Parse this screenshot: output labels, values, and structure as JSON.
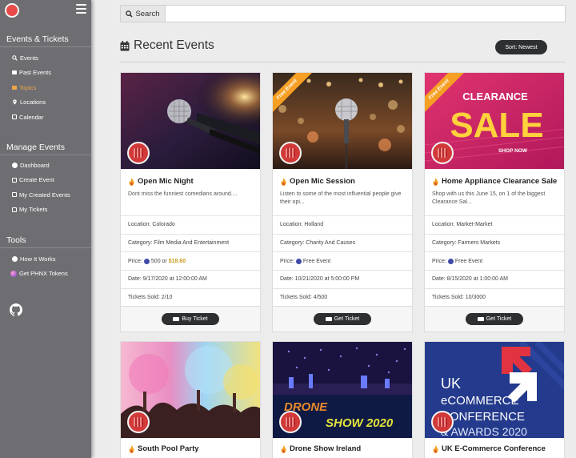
{
  "sidebar": {
    "sections": [
      {
        "title": "Events & Tickets",
        "items": [
          {
            "label": "Events",
            "icon": "search-icon"
          },
          {
            "label": "Past Events",
            "icon": "archive-icon"
          },
          {
            "label": "Topics",
            "icon": "folder-icon",
            "active": true
          },
          {
            "label": "Locations",
            "icon": "map-marker-icon"
          },
          {
            "label": "Calendar",
            "icon": "calendar-icon"
          }
        ]
      },
      {
        "title": "Manage Events",
        "items": [
          {
            "label": "Dashboard",
            "icon": "dashboard-icon"
          },
          {
            "label": "Create Event",
            "icon": "edit-icon"
          },
          {
            "label": "My Created Events",
            "icon": "list-icon"
          },
          {
            "label": "My Tickets",
            "icon": "ticket-icon"
          }
        ]
      },
      {
        "title": "Tools",
        "items": [
          {
            "label": "How It Works",
            "icon": "question-circle-icon"
          },
          {
            "label": "Get PHNX Tokens",
            "icon": "phnx-token-icon"
          }
        ]
      }
    ]
  },
  "search": {
    "button_label": "Search",
    "placeholder": ""
  },
  "page": {
    "title": "Recent Events",
    "sort_label": "Sort: Newest"
  },
  "colors": {
    "accent": "#f0a64a",
    "sidebar": "#6e6e72",
    "button": "#2e2f31",
    "ribbon": "#f5a025"
  },
  "cards": [
    {
      "title": "Open Mic Night",
      "desc": "Dont miss the funniest comedians around....",
      "location": "Location: Colorado",
      "category": "Category: Film Media And Entertainment",
      "price_prefix": "Price: ",
      "price_phnx": "500 or ",
      "price_usd": "$18.60",
      "date": "Date: 9/17/2020 at 12:00:00 AM",
      "tickets": "Tickets Sold: 2/10",
      "button": "Buy Ticket"
    },
    {
      "ribbon": "Free Event",
      "title": "Open Mic Session",
      "desc": "Listen to some of the most influential people give their opi...",
      "location": "Location: Holland",
      "category": "Category: Charity And Causes",
      "price_prefix": "Price: ",
      "price_phnx": "Free Event",
      "date": "Date: 10/21/2020 at 5:00:00 PM",
      "tickets": "Tickets Sold: 4/500",
      "button": "Get Ticket"
    },
    {
      "ribbon": "Free Event",
      "title": "Home Appliance Clearance Sale",
      "desc": "Shop with us this June 15, on 1 of the biggest Clearance Sal...",
      "location": "Location: Market-Market",
      "category": "Category: Farmers Markets",
      "price_prefix": "Price: ",
      "price_phnx": "Free Event",
      "date": "Date: 8/15/2020 at 1:00:00 AM",
      "tickets": "Tickets Sold: 10/3000",
      "button": "Get Ticket",
      "image_text": {
        "line1": "CLEARANCE",
        "line2": "SALE",
        "line3": "SHOP NOW"
      }
    },
    {
      "title": "South Pool Party"
    },
    {
      "title": "Drone Show Ireland",
      "image_text": {
        "line1": "DRONE",
        "line2": "SHOW 2020"
      }
    },
    {
      "title": "UK E-Commerce Conference",
      "image_text": {
        "line1": "UK",
        "line2": "eCOMMERCE",
        "line3": "CONFERENCE",
        "line4": "& AWARDS 2020"
      }
    }
  ]
}
